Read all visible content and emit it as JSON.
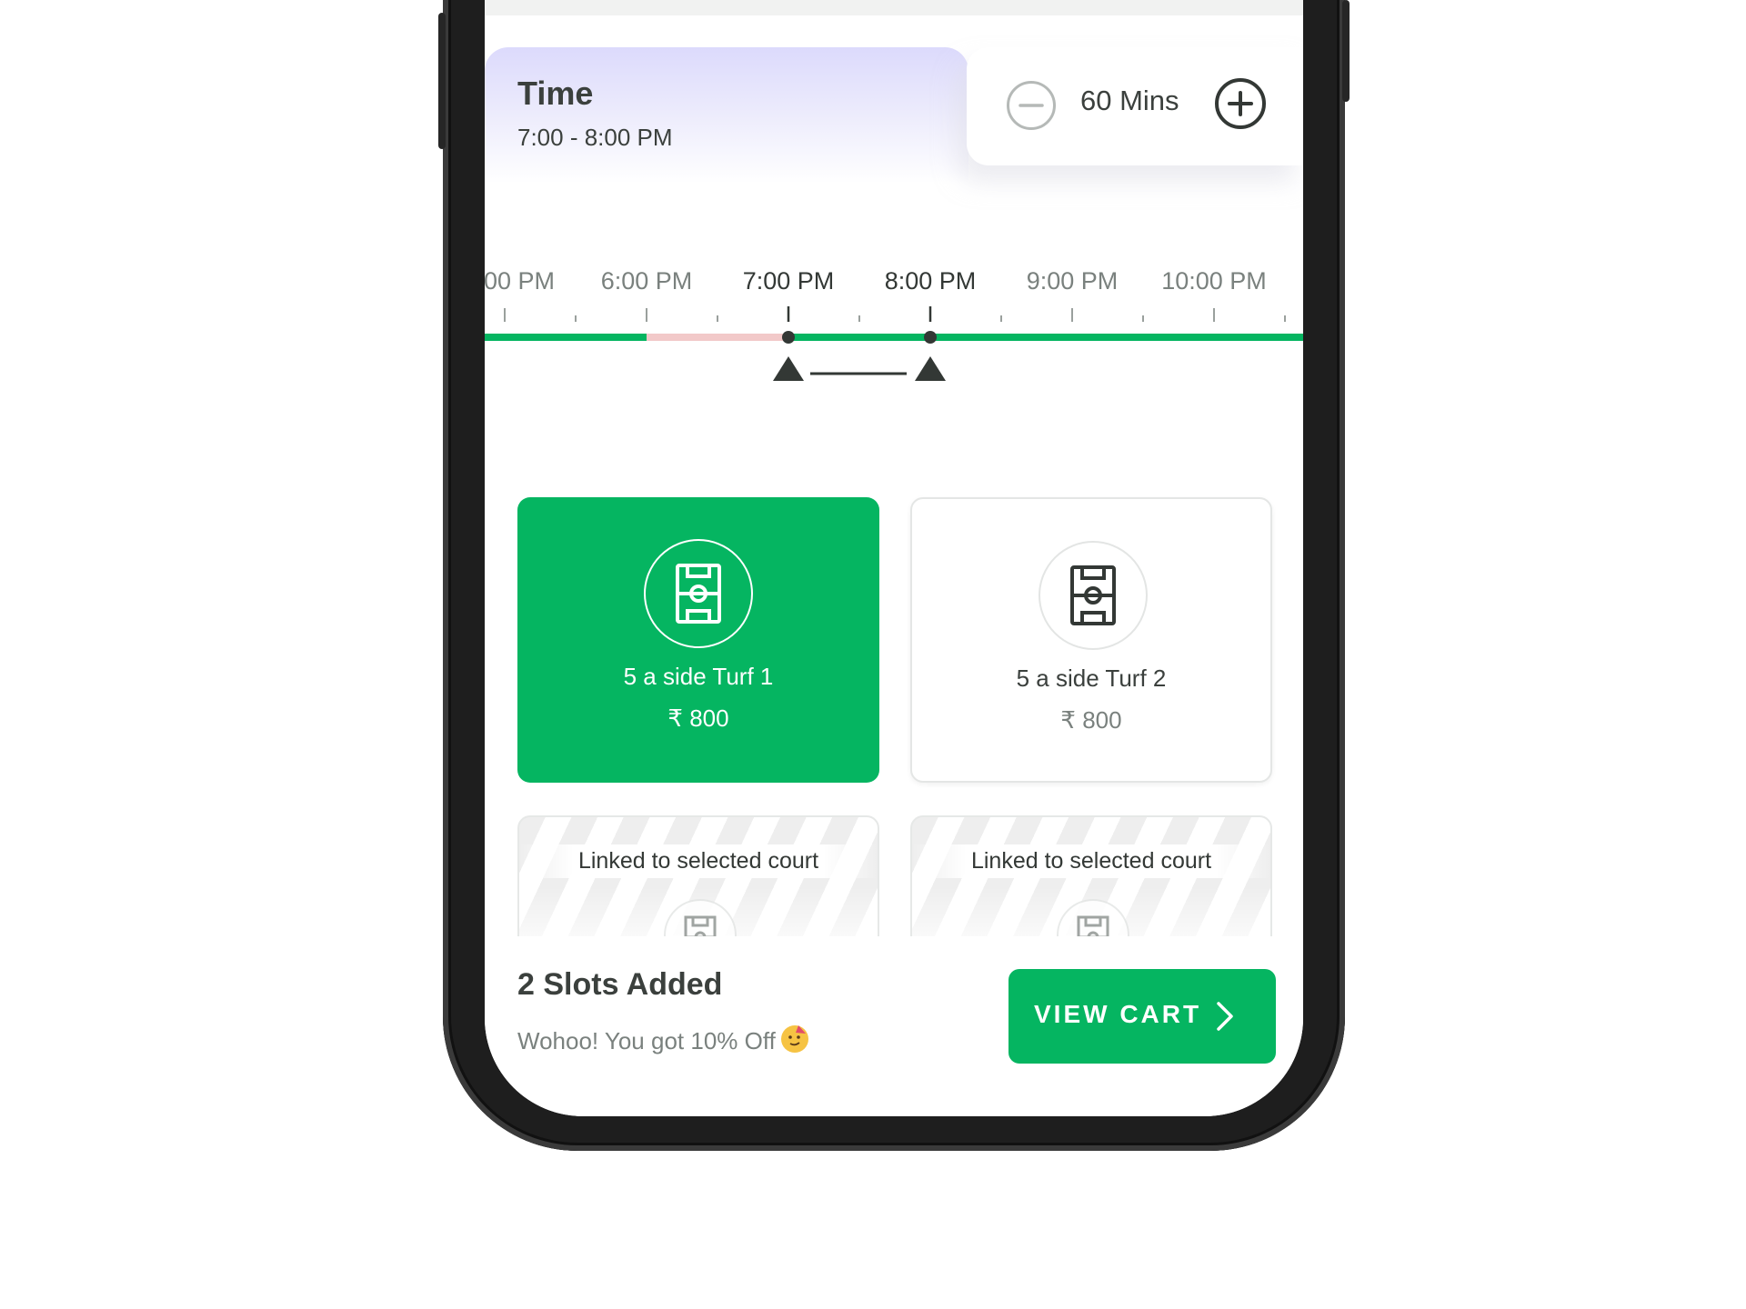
{
  "time_section": {
    "title": "Time",
    "range": "7:00 - 8:00 PM"
  },
  "duration": {
    "value": "60 Mins",
    "minus_icon": "minus-circle-icon",
    "plus_icon": "plus-circle-icon"
  },
  "timeline": {
    "tick_labels": [
      "00 PM",
      "6:00 PM",
      "7:00 PM",
      "8:00 PM",
      "9:00 PM",
      "10:00 PM"
    ],
    "selected_start": "7:00 PM",
    "selected_end": "8:00 PM",
    "colors": {
      "available": "#05b561",
      "booked": "#f2c9c9",
      "marker": "#333835"
    }
  },
  "turfs": [
    {
      "name": "5 a side Turf 1",
      "price": "₹ 800",
      "selected": true,
      "icon": "football-field-icon"
    },
    {
      "name": "5 a side Turf 2",
      "price": "₹ 800",
      "selected": false,
      "icon": "football-field-icon"
    }
  ],
  "linked_courts": [
    {
      "label": "Linked to selected court",
      "icon": "football-field-icon"
    },
    {
      "label": "Linked to selected court",
      "icon": "football-field-icon"
    }
  ],
  "cart": {
    "slots_title": "2 Slots Added",
    "discount_text": "Wohoo! You got 10% Off",
    "discount_icon": "party-face-icon",
    "button_label": "VIEW CART",
    "button_icon": "chevron-right-icon"
  },
  "colors": {
    "brand_green": "#05b561",
    "text_dark": "#3b403d",
    "text_muted": "#7a817e",
    "header_gradient": "#dcdafc"
  }
}
